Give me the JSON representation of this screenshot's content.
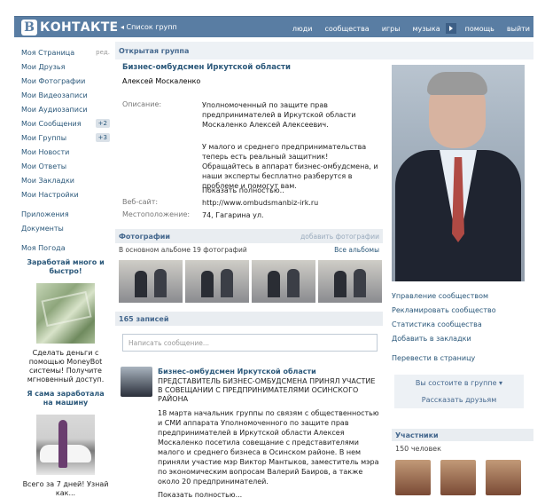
{
  "topbar": {
    "logo_letter": "В",
    "logo_text": "КОНТАКТЕ",
    "back_link": "◂ Список групп",
    "nav": [
      "люди",
      "сообщества",
      "игры",
      "музыка",
      "помощь",
      "выйти"
    ],
    "color": "#597da3"
  },
  "sidebar": {
    "items": [
      {
        "label": "Моя Страница",
        "extra": "ред."
      },
      {
        "label": "Мои Друзья",
        "extra": ""
      },
      {
        "label": "Мои Фотографии",
        "extra": ""
      },
      {
        "label": "Мои Видеозаписи",
        "extra": ""
      },
      {
        "label": "Мои Аудиозаписи",
        "extra": ""
      },
      {
        "label": "Мои Сообщения",
        "extra": "+2"
      },
      {
        "label": "Мои Группы",
        "extra": "+3"
      },
      {
        "label": "Мои Новости",
        "extra": ""
      },
      {
        "label": "Мои Ответы",
        "extra": ""
      },
      {
        "label": "Мои Закладки",
        "extra": ""
      },
      {
        "label": "Мои Настройки",
        "extra": ""
      }
    ],
    "apps": "Приложения",
    "docs": "Документы",
    "weather": "Моя Погода",
    "promo1_title": "Заработай много и быстро!",
    "promo1_text": "Сделать деньги с помощью MoneyBot системы! Получите мгновенный доступ.",
    "promo2_title": "Я сама заработала на машину",
    "promo2_text": "Всего за 7 дней! Узнай как..."
  },
  "group": {
    "type": "Открытая группа",
    "name": "Бизнес-омбудсмен Иркутской области",
    "author": "Алексей Москаленко",
    "desc_label": "Описание:",
    "desc_1": "Уполномоченный по защите прав предпринимателей в Иркутской области Москаленко Алексей Алексеевич.",
    "desc_2": "У малого и среднего предпринимательства теперь есть реальный защитник! Обращайтесь в аппарат бизнес-омбудсмена, и наши эксперты бесплатно разберутся в проблеме и помогут вам.",
    "show_more": "Показать полностью..",
    "website_label": "Веб-сайт:",
    "website": "http://www.ombudsmanbiz-irk.ru",
    "location_label": "Местоположение:",
    "location": "74, Гагарина ул."
  },
  "photos": {
    "title": "Фотографии",
    "add": "добавить фотографии",
    "subtitle": "В основном альбоме 19 фотографий",
    "all_albums": "Все альбомы"
  },
  "wall": {
    "count": "165 записей",
    "input_placeholder": "Написать сообщение...",
    "post": {
      "author": "Бизнес-омбудсмен Иркутской области",
      "headline": "ПРЕДСТАВИТЕЛЬ БИЗНЕС-ОМБУДСМЕНА ПРИНЯЛ УЧАСТИЕ В СОВЕЩАНИИ С ПРЕДПРИНИМАТЕЛЯМИ ОСИНСКОГО РАЙОНА",
      "body": "18 марта начальник группы по связям с общественностью и СМИ аппарата Уполномоченного по защите прав предпринимателей в Иркутской области Алексея Москаленко посетила совещание с представителями малого и среднего бизнеса в Осинском районе. В нем приняли участие мэр Виктор Мантыков, заместитель мэра по экономическим вопросам Валерий Баиров, а также около 20 предпринимателей.",
      "show_more": "Показать полностью..."
    }
  },
  "right": {
    "links": [
      "Управление сообществом",
      "Рекламировать сообщество",
      "Статистика сообщества",
      "Добавить в закладки"
    ],
    "translate": "Перевести в страницу",
    "in_group": "Вы состоите в группе ▾",
    "tell_friends": "Рассказать друзьям",
    "members_title": "Участники",
    "members_count": "150 человек"
  }
}
